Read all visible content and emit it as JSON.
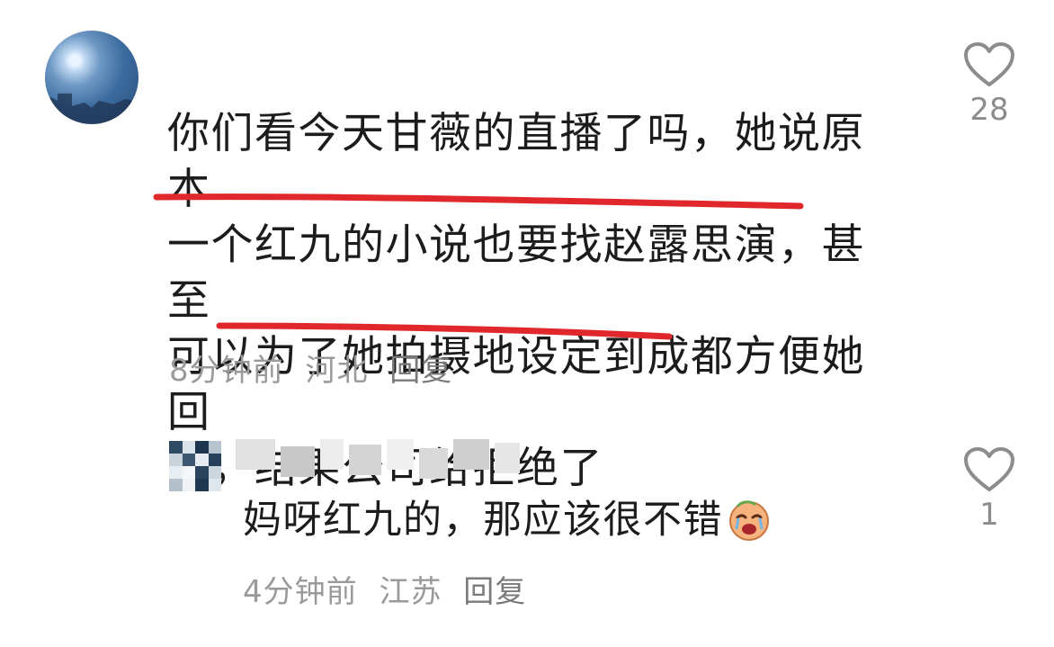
{
  "comment": {
    "lines": [
      "你们看今天甘薇的直播了吗，她说原本",
      "一个红九的小说也要找赵露思演，甚至",
      "可以为了她拍摄地设定到成都方便她回",
      "家，结果公司给拒绝了"
    ],
    "time": "8分钟前",
    "location": "河北",
    "reply_label": "回复",
    "likes": "28",
    "avatar_icon": "sky-photo-avatar",
    "highlight_color": "#e0282c"
  },
  "reply": {
    "username_icon": "pixelated-username",
    "text": "妈呀红九的，那应该很不错",
    "emoji": "crying-face-emoji",
    "time": "4分钟前",
    "location": "江苏",
    "reply_label": "回复",
    "likes": "1"
  }
}
